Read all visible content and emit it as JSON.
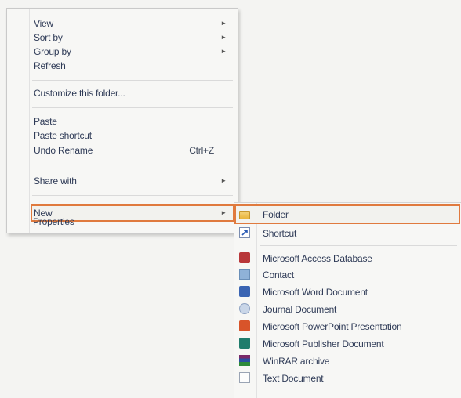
{
  "context_menu": {
    "items": [
      {
        "label": "View",
        "arrow": "►"
      },
      {
        "label": "Sort by",
        "arrow": "►"
      },
      {
        "label": "Group by",
        "arrow": "►"
      },
      {
        "label": "Refresh"
      },
      {
        "label": "Customize this folder..."
      },
      {
        "label": "Paste"
      },
      {
        "label": "Paste shortcut"
      },
      {
        "label": "Undo Rename",
        "shortcut": "Ctrl+Z"
      },
      {
        "label": "Share with",
        "arrow": "►"
      },
      {
        "label": "New",
        "arrow": "►"
      },
      {
        "label": "Properties"
      }
    ]
  },
  "new_submenu": {
    "items": [
      {
        "label": "Folder",
        "icon": "folder-icon"
      },
      {
        "label": "Shortcut",
        "icon": "shortcut-icon"
      },
      {
        "label": "Microsoft Access Database",
        "icon": "access-icon"
      },
      {
        "label": "Contact",
        "icon": "contact-icon"
      },
      {
        "label": "Microsoft Word Document",
        "icon": "word-icon"
      },
      {
        "label": "Journal Document",
        "icon": "journal-icon"
      },
      {
        "label": "Microsoft PowerPoint Presentation",
        "icon": "powerpoint-icon"
      },
      {
        "label": "Microsoft Publisher Document",
        "icon": "publisher-icon"
      },
      {
        "label": "WinRAR archive",
        "icon": "winrar-icon"
      },
      {
        "label": "Text Document",
        "icon": "text-icon"
      }
    ]
  },
  "colors": {
    "highlight_border": "#e07a3e",
    "menu_bg": "#f7f7f5",
    "text": "#2f3b57"
  }
}
